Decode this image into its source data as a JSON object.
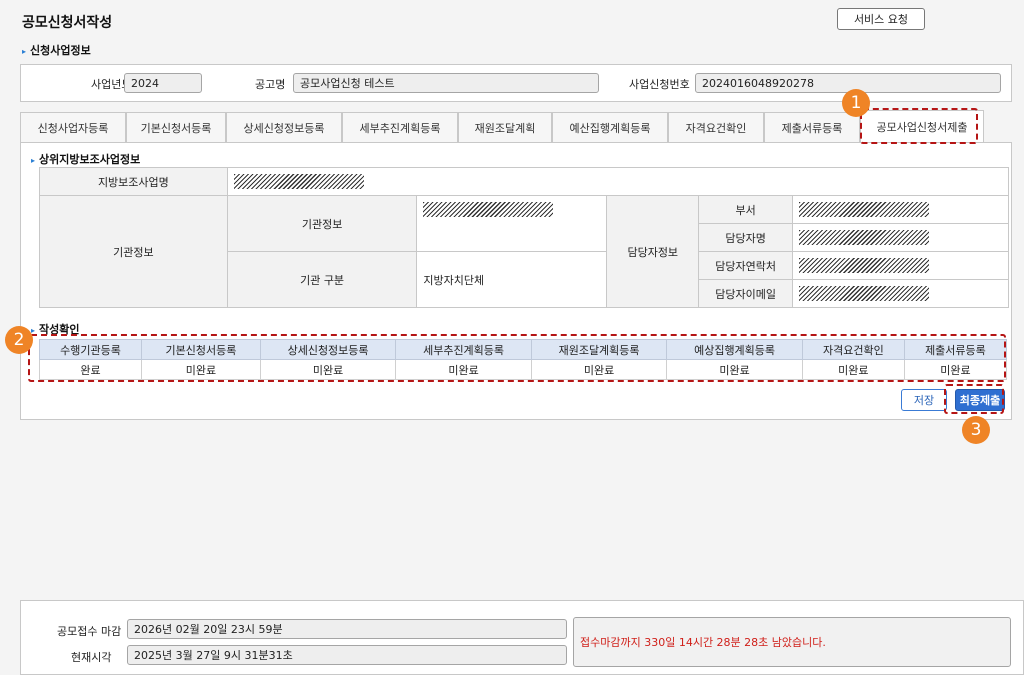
{
  "page": {
    "title": "공모신청서작성",
    "service_button": "서비스 요청"
  },
  "section_apply": {
    "title": "신청사업정보"
  },
  "info": {
    "year_label": "사업년도",
    "year_value": "2024",
    "notice_label": "공고명",
    "notice_value": "공모사업신청 테스트",
    "appno_label": "사업신청번호",
    "appno_value": "2024016048920278"
  },
  "tabs": [
    {
      "label": "신청사업자등록"
    },
    {
      "label": "기본신청서등록"
    },
    {
      "label": "상세신청정보등록"
    },
    {
      "label": "세부추진계획등록"
    },
    {
      "label": "재원조달계획"
    },
    {
      "label": "예산집행계획등록"
    },
    {
      "label": "자격요건확인"
    },
    {
      "label": "제출서류등록"
    },
    {
      "label": "공모사업신청서제출"
    }
  ],
  "section_parent": {
    "title": "상위지방보조사업정보"
  },
  "parent": {
    "project_label": "지방보조사업명",
    "org_label": "기관정보",
    "org_info_label": "기관정보",
    "org_type_label": "기관 구분",
    "org_type_value": "지방자치단체",
    "contact_label": "담당자정보",
    "dept_label": "부서",
    "person_label": "담당자명",
    "phone_label": "담당자연락처",
    "email_label": "담당자이메일"
  },
  "section_confirm": {
    "title": "작성확인"
  },
  "confirm": {
    "headers": [
      "수행기관등록",
      "기본신청서등록",
      "상세신청정보등록",
      "세부추진계획등록",
      "재원조달계획등록",
      "예상집행계획등록",
      "자격요건확인",
      "제출서류등록"
    ],
    "values": [
      "완료",
      "미완료",
      "미완료",
      "미완료",
      "미완료",
      "미완료",
      "미완료",
      "미완료"
    ]
  },
  "buttons": {
    "save": "저장",
    "final_submit": "최종제출"
  },
  "badges": [
    "1",
    "2",
    "3"
  ],
  "footer": {
    "deadline_label": "공모접수 마감",
    "deadline_value": "2026년 02월 20일 23시 59분",
    "now_label": "현재시각",
    "now_value": "2025년 3월 27일 9시 31분31초",
    "remaining": "접수마감까지 330일 14시간 28분 28초 남았습니다."
  },
  "colors": {
    "accent": "#2f6fd1",
    "highlight": "#b51515",
    "badge": "#ef8426",
    "warning_text": "#d0201a"
  }
}
